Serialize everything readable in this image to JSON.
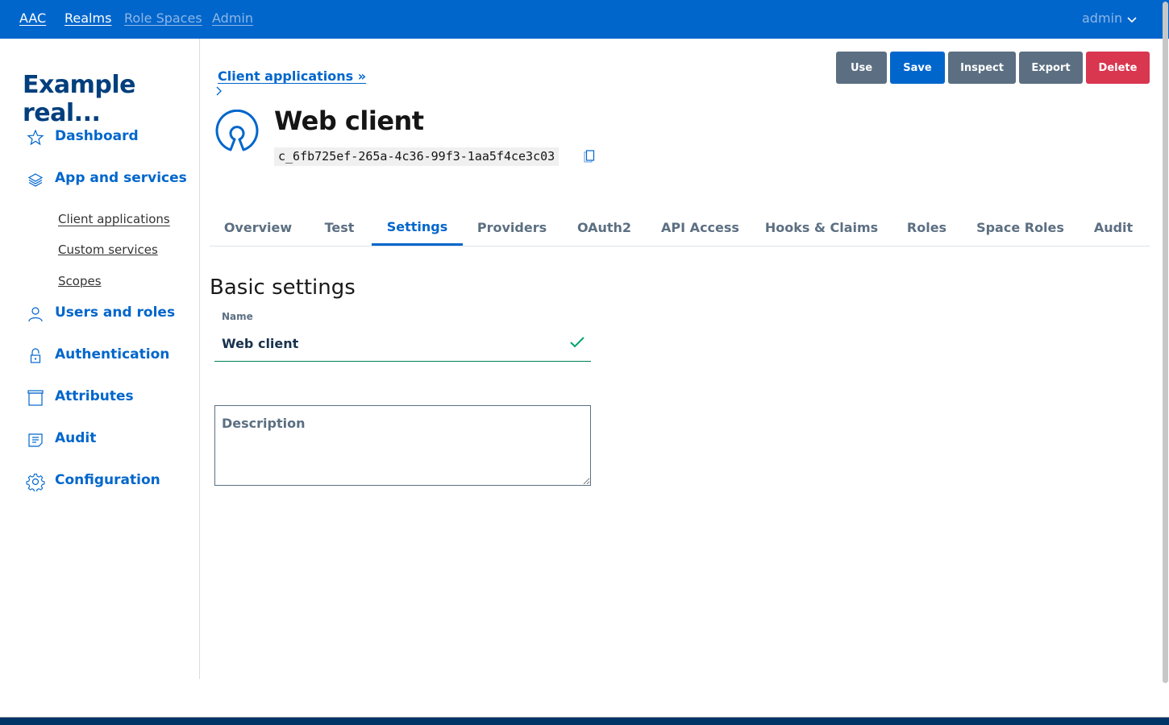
{
  "topbar": {
    "brand": "AAC",
    "links": [
      {
        "label": "Realms",
        "active": true
      },
      {
        "label": "Role Spaces",
        "active": false
      },
      {
        "label": "Admin",
        "active": false
      }
    ],
    "user": "admin"
  },
  "sidebar": {
    "realm_title": "Example real...",
    "items": [
      {
        "label": "Dashboard",
        "icon": "star-icon"
      },
      {
        "label": "App and services",
        "icon": "layers-icon"
      },
      {
        "label": "Users and roles",
        "icon": "user-icon"
      },
      {
        "label": "Authentication",
        "icon": "lock-icon"
      },
      {
        "label": "Attributes",
        "icon": "archive-icon"
      },
      {
        "label": "Audit",
        "icon": "note-icon"
      },
      {
        "label": "Configuration",
        "icon": "gear-icon"
      }
    ],
    "subitems": [
      {
        "label": "Client applications",
        "active": true
      },
      {
        "label": "Custom services",
        "active": false
      },
      {
        "label": "Scopes",
        "active": false
      }
    ]
  },
  "header": {
    "breadcrumb": "Client applications »",
    "title": "Web client",
    "client_id": "c_6fb725ef-265a-4c36-99f3-1aa5f4ce3c03"
  },
  "actions": {
    "use": "Use",
    "save": "Save",
    "inspect": "Inspect",
    "export": "Export",
    "delete": "Delete"
  },
  "tabs": [
    {
      "label": "Overview",
      "active": false
    },
    {
      "label": "Test",
      "active": false
    },
    {
      "label": "Settings",
      "active": true
    },
    {
      "label": "Providers",
      "active": false
    },
    {
      "label": "OAuth2",
      "active": false
    },
    {
      "label": "API Access",
      "active": false
    },
    {
      "label": "Hooks & Claims",
      "active": false
    },
    {
      "label": "Roles",
      "active": false
    },
    {
      "label": "Space Roles",
      "active": false
    },
    {
      "label": "Audit",
      "active": false
    }
  ],
  "form": {
    "section_title": "Basic settings",
    "name_label": "Name",
    "name_value": "Web client",
    "description_placeholder": "Description",
    "description_value": ""
  },
  "colors": {
    "primary": "#0066cc",
    "secondary": "#5c6f82",
    "danger": "#d9364f",
    "success": "#008055",
    "realm_title": "#003f7d"
  }
}
